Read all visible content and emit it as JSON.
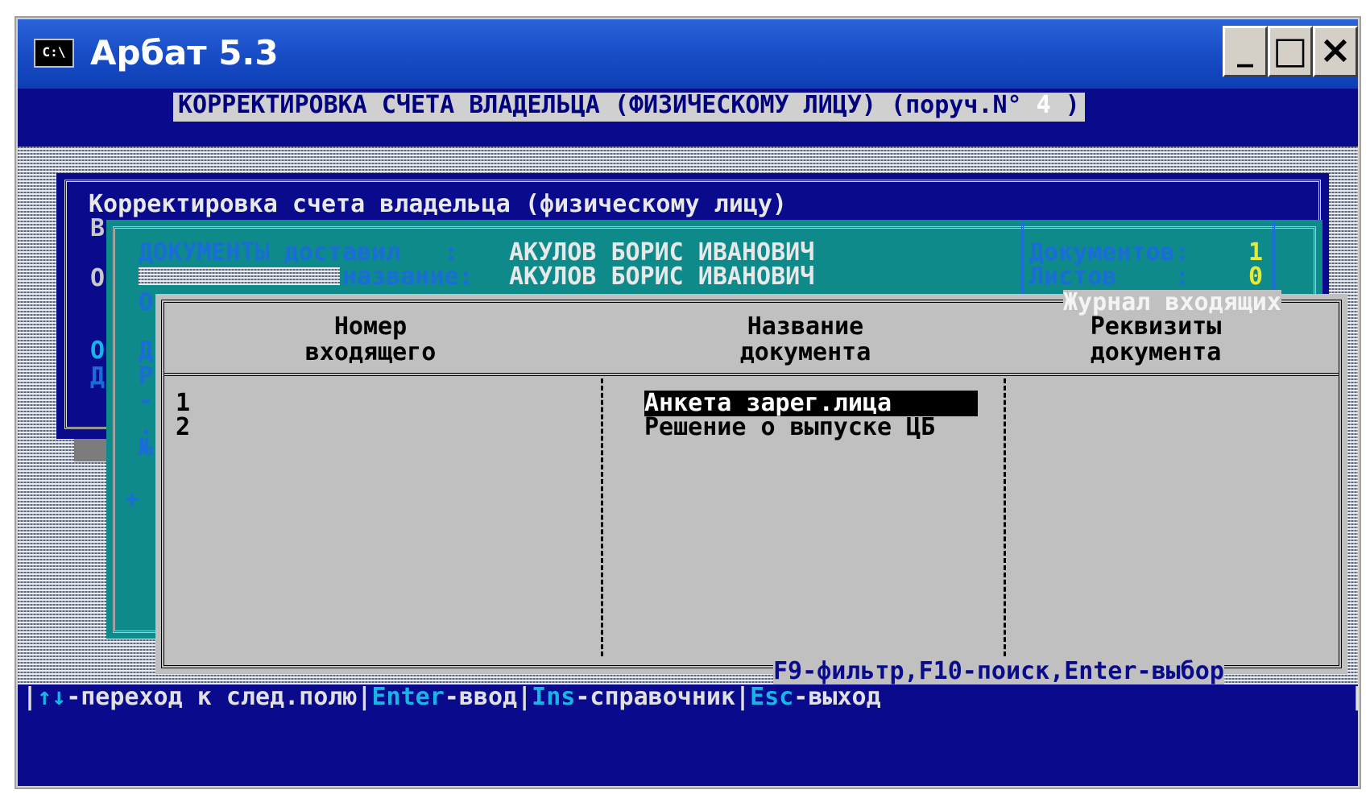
{
  "window": {
    "title": "Арбат 5.3",
    "icon_label": "C:\\",
    "controls": {
      "minimize": "_",
      "maximize": "□",
      "close": "×"
    }
  },
  "screen": {
    "header": "КОРРЕКТИРОВКА СЧЕТА ВЛАДЕЛЬЦА (ФИЗИЧЕСКОМУ ЛИЦУ) (поруч.N° ",
    "header_number": "4",
    "header_end": " )"
  },
  "owner_dialog": {
    "title": "Корректировка счета владельца (физическому лицу)",
    "left_chars": [
      "В",
      "О",
      "О",
      "Д"
    ]
  },
  "documents_panel": {
    "delivered_label": "ДОКУМЕНТЫ доставил   :",
    "delivered_value": "АКУЛОВ БОРИС ИВАНОВИЧ",
    "name_label": "название:",
    "name_value": "АКУЛОВ БОРИС ИВАНОВИЧ",
    "documents_count_label": "Документов:",
    "documents_count": "1",
    "sheets_label": "Листов    :",
    "sheets_count": "0",
    "side_chars": [
      "О",
      "Д",
      "Р",
      "-",
      ".",
      "№",
      "+"
    ]
  },
  "journal": {
    "title": "Журнал входящих",
    "columns": [
      {
        "line1": "Номер",
        "line2": "входящего"
      },
      {
        "line1": "Название",
        "line2": "документа"
      },
      {
        "line1": "Реквизиты",
        "line2": "документа"
      }
    ],
    "rows": [
      {
        "number": "1",
        "name": "Анкета зарег.лица",
        "details": ""
      },
      {
        "number": "2",
        "name": "Решение о выпуске ЦБ",
        "details": ""
      }
    ],
    "footer": "F9-фильтр,F10-поиск,Enter-выбор"
  },
  "status_bar": {
    "items": [
      {
        "key": "↑↓",
        "text": "-переход к след.полю"
      },
      {
        "key": "Enter",
        "text": "-ввод"
      },
      {
        "key": "Ins",
        "text": "-справочник"
      },
      {
        "key": "Esc",
        "text": "-выход"
      }
    ]
  }
}
